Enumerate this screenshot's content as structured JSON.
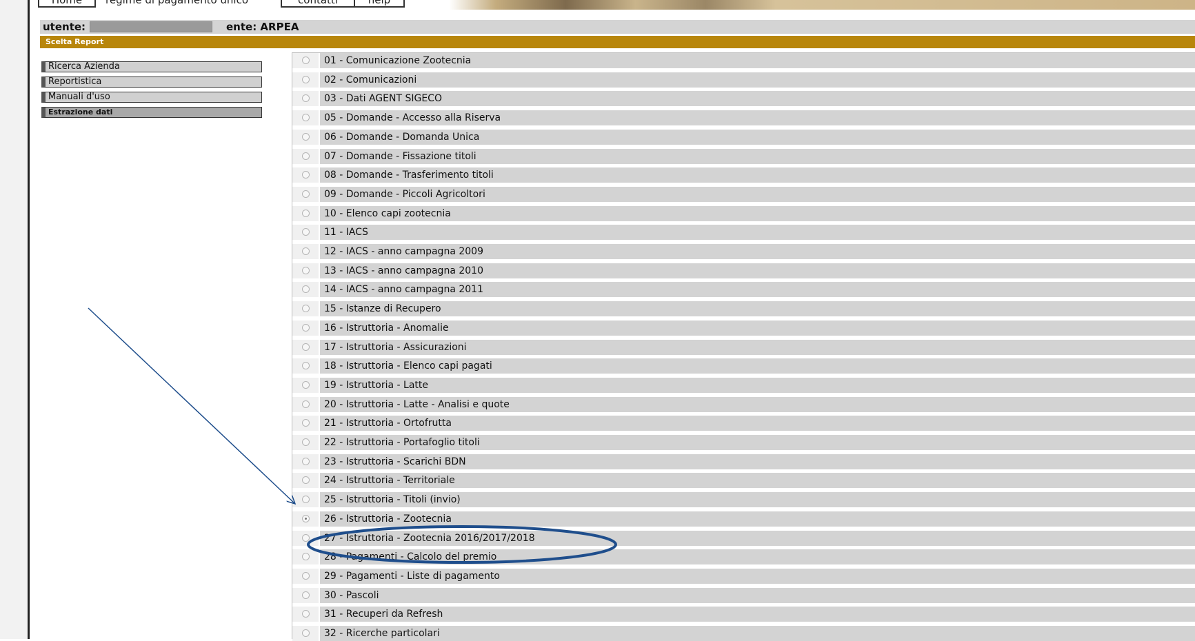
{
  "nav": {
    "home_label": "Home",
    "regime_label": "regime di pagamento unico",
    "contatti_label": "contatti",
    "help_label": "help"
  },
  "user_bar": {
    "user_label": "utente:",
    "ente_label": "ente: ARPEA"
  },
  "section": {
    "title": "Scelta Report"
  },
  "sidebar": {
    "items": [
      {
        "label": "Ricerca Azienda",
        "active": false
      },
      {
        "label": "Reportistica",
        "active": false
      },
      {
        "label": "Manuali d'uso",
        "active": false
      },
      {
        "label": "Estrazione dati",
        "active": true
      }
    ]
  },
  "reports": {
    "selected_index": 24,
    "items": [
      "01 - Comunicazione Zootecnia",
      "02 - Comunicazioni",
      "03 - Dati AGENT SIGECO",
      "05 - Domande - Accesso alla Riserva",
      "06 - Domande - Domanda Unica",
      "07 - Domande - Fissazione titoli",
      "08 - Domande - Trasferimento titoli",
      "09 - Domande - Piccoli Agricoltori",
      "10 - Elenco capi zootecnia",
      "11 - IACS",
      "12 - IACS - anno campagna 2009",
      "13 - IACS - anno campagna 2010",
      "14 - IACS - anno campagna 2011",
      "15 - Istanze di Recupero",
      "16 - Istruttoria - Anomalie",
      "17 - Istruttoria - Assicurazioni",
      "18 - Istruttoria - Elenco capi pagati",
      "19 - Istruttoria - Latte",
      "20 - Istruttoria - Latte - Analisi e quote",
      "21 - Istruttoria - Ortofrutta",
      "22 - Istruttoria - Portafoglio titoli",
      "23 - Istruttoria - Scarichi BDN",
      "24 - Istruttoria - Territoriale",
      "25 - Istruttoria - Titoli (invio)",
      "26 - Istruttoria - Zootecnia",
      "27 - Istruttoria - Zootecnia 2016/2017/2018",
      "28 - Pagamenti - Calcolo del premio",
      "29 - Pagamenti - Liste di pagamento",
      "30 - Pascoli",
      "31 - Recuperi da Refresh",
      "32 - Ricerche particolari"
    ]
  },
  "colors": {
    "section_bar": "#b8860b",
    "annotation": "#1f4e8c"
  }
}
